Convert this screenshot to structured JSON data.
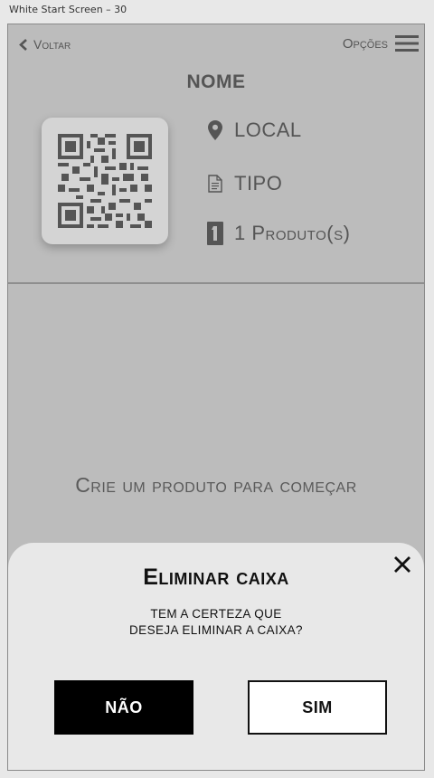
{
  "window": {
    "title": "White Start Screen – 30"
  },
  "header": {
    "back_label": "Voltar",
    "options_label": "Opções",
    "title": "NOME"
  },
  "details": {
    "location": "LOCAL",
    "type": "TIPO",
    "products_count": "1",
    "products_label": "1 Produto(s)"
  },
  "empty_state": {
    "message": "Crie um produto para começar"
  },
  "dialog": {
    "title": "Eliminar caixa",
    "message": "TEM A CERTEZA QUE DESEJA ELIMINAR A CAIXA?",
    "no_label": "NÃO",
    "yes_label": "SIM"
  },
  "icons": {
    "back": "chevron-left-icon",
    "menu": "hamburger-menu-icon",
    "location": "map-pin-icon",
    "type": "document-icon",
    "products": "number-one-icon",
    "close": "close-icon"
  },
  "colors": {
    "background": "#bcbcbc",
    "dialog": "#e8e8e8",
    "primary_button": "#000000"
  }
}
